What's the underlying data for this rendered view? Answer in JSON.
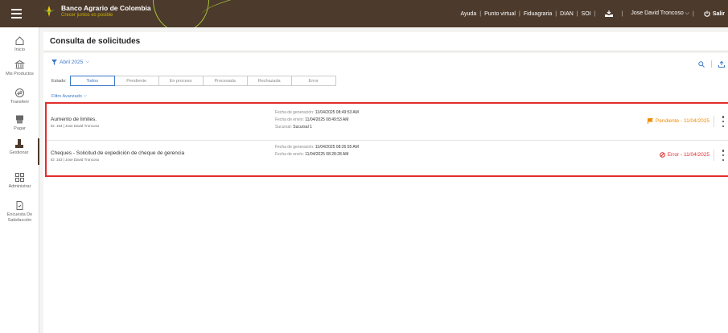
{
  "topbar": {
    "bank_name": "Banco Agrario de Colombia",
    "slogan": "Crecer juntos es posible",
    "links": [
      "Ayuda",
      "Punto virtual",
      "Fiduagraria",
      "DIAN",
      "SOI"
    ],
    "user": "Jose David Troncoso",
    "logout": "Salir"
  },
  "sidebar": {
    "items": [
      {
        "label": "Inicio",
        "icon": "home-icon"
      },
      {
        "label": "Mis Productos",
        "icon": "bank-icon"
      },
      {
        "label": "Transferir",
        "icon": "transfer-icon"
      },
      {
        "label": "Pagar",
        "icon": "payment-icon"
      },
      {
        "label": "Gestionar",
        "icon": "manage-icon"
      },
      {
        "label": "Administrar",
        "icon": "grid-icon"
      },
      {
        "label": "Encuesta De Satisfacción",
        "icon": "survey-icon"
      }
    ]
  },
  "page": {
    "title": "Consulta de solicitudes",
    "date_filter": "Abril 2025",
    "estado_label": "Estado:",
    "status_tabs": [
      "Todos",
      "Pendiente",
      "En proceso",
      "Procesada",
      "Rechazada",
      "Error"
    ],
    "selected_tab": "Todos",
    "advanced_filter": "Filtro Avanzado"
  },
  "requests": [
    {
      "title": "Aumento de limites.",
      "subtitle": "ID: 154 | Jose David Troncoso",
      "gen_label": "Fecha de generación:",
      "gen_value": "11/04/2025 08:49:53 AM",
      "send_label": "Fecha de envío:",
      "send_value": "11/04/2025 08:49:53 AM",
      "branch_label": "Sucursal:",
      "branch_value": "Sucursal 1",
      "status": "Pendiente - 11/04/2025",
      "status_color": "#f08c00"
    },
    {
      "title": "Cheques - Solicitud de expedición de cheque de gerencia",
      "subtitle": "ID: 153 | Jose David Troncoso",
      "gen_label": "Fecha de generación:",
      "gen_value": "11/04/2025 08:26:55 AM",
      "send_label": "Fecha de envío:",
      "send_value": "11/04/2025 08:28:28 AM",
      "status": "Error - 11/04/2025",
      "status_color": "#e32d2d"
    }
  ],
  "colors": {
    "brand_brown": "#4c3a2c",
    "accent_blue": "#3b78c9",
    "highlight_red": "#e32d2d",
    "brand_green": "#a8c33a"
  }
}
